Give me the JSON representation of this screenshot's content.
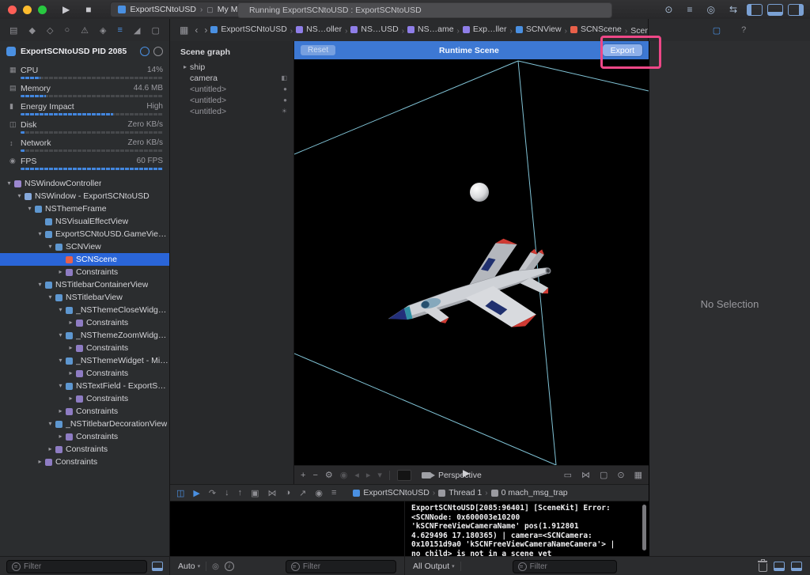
{
  "colors": {
    "accent": "#4a90e2",
    "selection": "#2a65d8",
    "runtime_bar": "#3d78d3",
    "annotation": "#ee4787",
    "gauge_fill": "#4286de",
    "wire": "#8fd9ee",
    "console_text": "#f0f0f2"
  },
  "tree_icon_colors": {
    "wc": "#9b87cf",
    "window": "#86a9dc",
    "view": "#5e97d0",
    "scene": "#e8604a",
    "constraints": "#8e7cc3",
    "textfield": "#5e97d0"
  },
  "window_controls": [
    {
      "name": "close-window-button",
      "color": "#ff5f57"
    },
    {
      "name": "minimize-window-button",
      "color": "#febc2e"
    },
    {
      "name": "zoom-window-button",
      "color": "#28c840"
    }
  ],
  "toolbar": {
    "run_icon": {
      "name": "run-button",
      "glyph": "▶"
    },
    "stop_icon": {
      "name": "stop-button",
      "glyph": "■"
    },
    "scheme": "ExportSCNtoUSD",
    "destination": "My Mac",
    "destination_icon": {
      "name": "destination-device-icon",
      "glyph": "▢"
    },
    "status": "Running ExportSCNtoUSD : ExportSCNtoUSD",
    "right_icons": [
      {
        "name": "activity-badge-icon",
        "kind": "glyph",
        "glyph": "⊙"
      },
      {
        "name": "editor-standard-icon",
        "kind": "glyph",
        "glyph": "≡"
      },
      {
        "name": "editor-assistant-icon",
        "kind": "glyph",
        "glyph": "◎"
      },
      {
        "name": "editor-version-icon",
        "kind": "glyph",
        "glyph": "⇆"
      },
      {
        "name": "navigator-panel-toggle",
        "kind": "panel",
        "side": "left"
      },
      {
        "name": "debug-panel-toggle",
        "kind": "panel",
        "side": "bottom"
      },
      {
        "name": "inspector-panel-toggle",
        "kind": "panel",
        "side": "right"
      }
    ]
  },
  "navigator_tabs": [
    {
      "name": "project-navigator-tab",
      "glyph": "▤"
    },
    {
      "name": "source-control-navigator-tab",
      "glyph": "◆"
    },
    {
      "name": "symbol-navigator-tab",
      "glyph": "◇"
    },
    {
      "name": "find-navigator-tab",
      "glyph": "○"
    },
    {
      "name": "issue-navigator-tab",
      "glyph": "⚠"
    },
    {
      "name": "test-navigator-tab",
      "glyph": "◈"
    },
    {
      "name": "debug-navigator-tab",
      "glyph": "≡",
      "active": true
    },
    {
      "name": "breakpoint-navigator-tab",
      "glyph": "◢"
    },
    {
      "name": "report-navigator-tab",
      "glyph": "▢"
    }
  ],
  "jumpbar": {
    "related_icon": {
      "name": "related-items-icon",
      "glyph": "▦"
    },
    "back_icon": {
      "name": "back-button",
      "glyph": "‹"
    },
    "forward_icon": {
      "name": "forward-button",
      "glyph": "›"
    },
    "separator": "›",
    "items": [
      {
        "label": "ExportSCNtoUSD",
        "color": "#4a90e2"
      },
      {
        "label": "NS…oller",
        "color": "#8f7ee8"
      },
      {
        "label": "NS…USD",
        "color": "#8f7ee8"
      },
      {
        "label": "NS…ame",
        "color": "#8f7ee8"
      },
      {
        "label": "Exp…ller",
        "color": "#8f7ee8"
      },
      {
        "label": "SCNView",
        "color": "#4a90e2"
      },
      {
        "label": "SCNScene",
        "color": "#e8604a"
      },
      {
        "label": "Scene graph",
        "color": null
      }
    ]
  },
  "navigator": {
    "process_label": "ExportSCNtoUSD PID 2085",
    "filter_placeholder": "Filter",
    "gauges": [
      {
        "label": "CPU",
        "value": "14%",
        "fill": 0.14,
        "icon": {
          "name": "cpu-icon",
          "glyph": "▦"
        }
      },
      {
        "label": "Memory",
        "value": "44.6 MB",
        "fill": 0.18,
        "icon": {
          "name": "memory-icon",
          "glyph": "▤"
        }
      },
      {
        "label": "Energy Impact",
        "value": "High",
        "fill": 0.65,
        "icon": {
          "name": "energy-icon",
          "glyph": "▮"
        }
      },
      {
        "label": "Disk",
        "value": "Zero KB/s",
        "fill": 0.03,
        "icon": {
          "name": "disk-icon",
          "glyph": "◫"
        }
      },
      {
        "label": "Network",
        "value": "Zero KB/s",
        "fill": 0.03,
        "icon": {
          "name": "network-icon",
          "glyph": "↕"
        }
      },
      {
        "label": "FPS",
        "value": "60 FPS",
        "fill": 1,
        "icon": {
          "name": "fps-icon",
          "glyph": "◉"
        }
      }
    ],
    "tree": [
      {
        "label": "NSWindowController",
        "depth": 0,
        "disc": "open",
        "type": "wc"
      },
      {
        "label": "NSWindow - ExportSCNtoUSD",
        "depth": 1,
        "disc": "open",
        "type": "window"
      },
      {
        "label": "NSThemeFrame",
        "depth": 2,
        "disc": "open",
        "type": "view"
      },
      {
        "label": "NSVisualEffectView",
        "depth": 3,
        "disc": null,
        "type": "view"
      },
      {
        "label": "ExportSCNtoUSD.GameViewC…",
        "depth": 3,
        "disc": "open",
        "type": "view"
      },
      {
        "label": "SCNView",
        "depth": 4,
        "disc": "open",
        "type": "view"
      },
      {
        "label": "SCNScene",
        "depth": 5,
        "disc": null,
        "type": "scene",
        "selected": true
      },
      {
        "label": "Constraints",
        "depth": 5,
        "disc": "closed",
        "type": "constraints"
      },
      {
        "label": "NSTitlebarContainerView",
        "depth": 3,
        "disc": "open",
        "type": "view"
      },
      {
        "label": "NSTitlebarView",
        "depth": 4,
        "disc": "open",
        "type": "view"
      },
      {
        "label": "_NSThemeCloseWidget -…",
        "depth": 5,
        "disc": "open",
        "type": "view"
      },
      {
        "label": "Constraints",
        "depth": 6,
        "disc": "closed",
        "type": "constraints"
      },
      {
        "label": "_NSThemeZoomWidget -…",
        "depth": 5,
        "disc": "open",
        "type": "view"
      },
      {
        "label": "Constraints",
        "depth": 6,
        "disc": "closed",
        "type": "constraints"
      },
      {
        "label": "_NSThemeWidget - Mini…",
        "depth": 5,
        "disc": "open",
        "type": "view"
      },
      {
        "label": "Constraints",
        "depth": 6,
        "disc": "closed",
        "type": "constraints"
      },
      {
        "label": "NSTextField - ExportSCN…",
        "depth": 5,
        "disc": "open",
        "type": "textfield"
      },
      {
        "label": "Constraints",
        "depth": 6,
        "disc": "closed",
        "type": "constraints"
      },
      {
        "label": "Constraints",
        "depth": 5,
        "disc": "closed",
        "type": "constraints"
      },
      {
        "label": "_NSTitlebarDecorationView",
        "depth": 4,
        "disc": "open",
        "type": "view"
      },
      {
        "label": "Constraints",
        "depth": 5,
        "disc": "closed",
        "type": "constraints"
      },
      {
        "label": "Constraints",
        "depth": 4,
        "disc": "closed",
        "type": "constraints"
      },
      {
        "label": "Constraints",
        "depth": 3,
        "disc": "closed",
        "type": "constraints"
      }
    ]
  },
  "scene_graph": {
    "title": "Scene graph",
    "nodes": [
      {
        "label": "ship",
        "disclosure": true,
        "right_icon": null
      },
      {
        "label": "camera",
        "disclosure": false,
        "right_icon": {
          "name": "camera-node-icon",
          "glyph": "◧"
        }
      },
      {
        "label": "<untitled>",
        "disclosure": false,
        "untitled": true,
        "right_icon": {
          "name": "sphere-node-icon",
          "glyph": "●"
        }
      },
      {
        "label": "<untitled>",
        "disclosure": false,
        "untitled": true,
        "right_icon": {
          "name": "sphere-node-icon",
          "glyph": "●"
        }
      },
      {
        "label": "<untitled>",
        "disclosure": false,
        "untitled": true,
        "right_icon": {
          "name": "light-node-icon",
          "glyph": "☀"
        }
      }
    ]
  },
  "scene_view": {
    "reset_label": "Reset",
    "title": "Runtime Scene",
    "export_label": "Export",
    "camera_label": "Perspective",
    "play_icon": {
      "name": "scene-play-button",
      "glyph": "▶"
    },
    "tools_left": [
      {
        "name": "add-node-button",
        "glyph": "+"
      },
      {
        "name": "remove-node-button",
        "glyph": "−"
      },
      {
        "name": "scene-settings-button",
        "glyph": "⚙"
      },
      {
        "name": "record-button",
        "glyph": "◉",
        "dim": true
      },
      {
        "name": "rewind-button",
        "glyph": "◂",
        "dim": true
      },
      {
        "name": "play-animation-button",
        "glyph": "▸",
        "dim": true
      },
      {
        "name": "loop-button",
        "glyph": "▾",
        "dim": true
      }
    ],
    "tools_right": [
      {
        "name": "render-mode-icon",
        "glyph": "▭"
      },
      {
        "name": "node-graph-icon",
        "glyph": "⋈"
      },
      {
        "name": "bounding-box-icon",
        "glyph": "▢"
      },
      {
        "name": "visibility-icon",
        "glyph": "⊙"
      },
      {
        "name": "snapshot-photo-icon",
        "glyph": "▦"
      }
    ]
  },
  "inspector": {
    "tabs": [
      {
        "name": "file-inspector-tab",
        "glyph": "▢",
        "active": true
      },
      {
        "name": "quick-help-inspector-tab",
        "glyph": "?"
      }
    ],
    "empty_text": "No Selection"
  },
  "debug": {
    "bar_icons": [
      {
        "name": "hide-debug-area-button",
        "glyph": "◫",
        "color": "#4a90e2"
      },
      {
        "name": "breakpoints-toggle-button",
        "glyph": "▶",
        "color": "#4a90e2"
      },
      {
        "name": "step-over-button",
        "glyph": "↷"
      },
      {
        "name": "step-into-button",
        "glyph": "↓"
      },
      {
        "name": "step-out-button",
        "glyph": "↑"
      },
      {
        "name": "view-hierarchy-button",
        "glyph": "▣"
      },
      {
        "name": "memory-graph-button",
        "glyph": "⋈"
      },
      {
        "name": "environment-overrides-button",
        "glyph": "◑"
      },
      {
        "name": "simulate-location-button",
        "glyph": "↗"
      },
      {
        "name": "screenshot-button",
        "glyph": "◉"
      },
      {
        "name": "stack-frames-button",
        "glyph": "≡"
      }
    ],
    "breadcrumb": [
      {
        "label": "ExportSCNtoUSD",
        "icon_color": "#4a90e2"
      },
      {
        "label": "Thread 1",
        "icon_color": "#9a9aa0"
      },
      {
        "label": "0 mach_msg_trap",
        "icon_color": "#9a9aa0"
      }
    ],
    "separator": "›",
    "variables_scope_label": "Auto",
    "variables_filter_placeholder": "Filter",
    "output_scope_label": "All Output",
    "console_filter_placeholder": "Filter",
    "console_lines": [
      "ExportSCNtoUSD[2085:96401] [SceneKit] Error:",
      "<SCNNode: 0x600003e10200",
      "'kSCNFreeViewCameraName' pos(1.912801",
      "4.629496 17.180365) | camera=<SCNCamera:",
      "0x10151d9a0 'kSCNFreeViewCameraNameCamera'> |",
      "no child> is not in a scene yet"
    ]
  }
}
